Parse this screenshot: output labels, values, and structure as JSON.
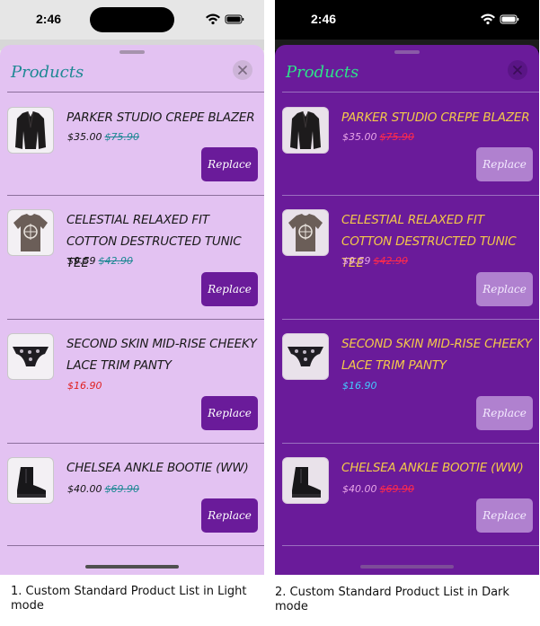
{
  "status": {
    "time": "2:46"
  },
  "sheet": {
    "title": "Products",
    "close_icon": "close-icon"
  },
  "products": [
    {
      "name": "PARKER STUDIO CREPE BLAZER",
      "price": "$35.00",
      "original_price": "$75.90",
      "on_sale": false,
      "thumbnail_icon": "blazer-icon"
    },
    {
      "name": "CELESTIAL RELAXED FIT COTTON DESTRUCTED TUNIC TEE",
      "price": "$9.59",
      "original_price": "$42.90",
      "on_sale": false,
      "thumbnail_icon": "tshirt-icon"
    },
    {
      "name": "SECOND SKIN MID-RISE CHEEKY LACE TRIM PANTY",
      "price": "$16.90",
      "original_price": "",
      "on_sale": true,
      "thumbnail_icon": "panty-icon"
    },
    {
      "name": "CHELSEA ANKLE BOOTIE (WW)",
      "price": "$40.00",
      "original_price": "$69.90",
      "on_sale": false,
      "thumbnail_icon": "boot-icon"
    }
  ],
  "replace_label": "Replace",
  "captions": {
    "light": "1. Custom Standard Product List in Light mode",
    "dark": "2. Custom Standard Product List in Dark mode"
  },
  "colors": {
    "light_sheet": "#e3c2f2",
    "light_accent": "#6a1b9a",
    "light_title": "#1f8894",
    "dark_sheet": "#6a1b9a",
    "dark_title": "#2ee08a",
    "dark_name": "#f3c84a",
    "dark_strike": "#ff2a4c",
    "dark_sale": "#44c9ff",
    "light_sale": "#e02020"
  }
}
